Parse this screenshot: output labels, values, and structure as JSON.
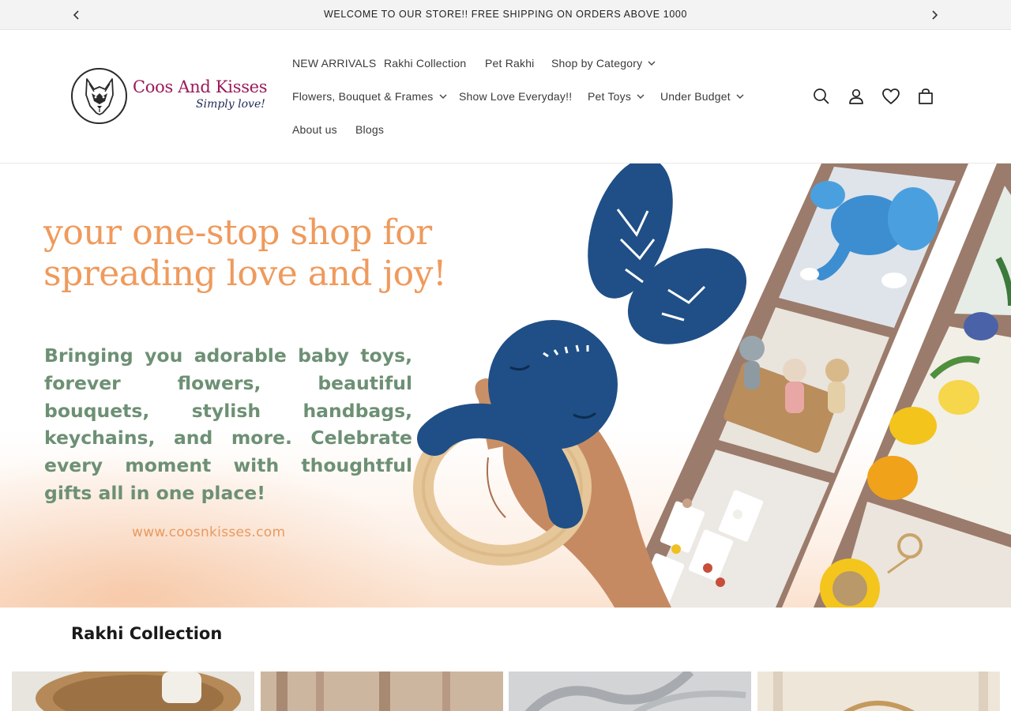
{
  "announcement": {
    "text": "WELCOME TO OUR STORE!! FREE SHIPPING ON ORDERS ABOVE 1000",
    "prev_icon": "chevron-left-icon",
    "next_icon": "chevron-right-icon"
  },
  "logo": {
    "brand": "Coos And Kisses",
    "tagline": "Simply love!",
    "emblem": "husky-dog-icon"
  },
  "nav": {
    "items": [
      {
        "label": "NEW ARRIVALS",
        "has_dropdown": false
      },
      {
        "label": "Rakhi Collection",
        "has_dropdown": false
      },
      {
        "label": "Pet Rakhi",
        "has_dropdown": false
      },
      {
        "label": "Shop by Category",
        "has_dropdown": true
      },
      {
        "label": "Flowers, Bouquet & Frames",
        "has_dropdown": true
      },
      {
        "label": "Show Love Everyday!!",
        "has_dropdown": false
      },
      {
        "label": "Pet Toys",
        "has_dropdown": true
      },
      {
        "label": "Under Budget",
        "has_dropdown": true
      },
      {
        "label": "About us",
        "has_dropdown": false
      },
      {
        "label": "Blogs",
        "has_dropdown": false
      }
    ]
  },
  "header_icons": [
    "search-icon",
    "account-icon",
    "wishlist-heart-icon",
    "cart-bag-icon"
  ],
  "hero": {
    "headline_line1": "your one-stop shop for",
    "headline_line2": "spreading love and joy!",
    "body": "Bringing you adorable baby toys, forever flowers, beautiful bouquets, stylish handbags, keychains, and more. Celebrate every moment with thoughtful gifts all in one place!",
    "url": "www.coosnkisses.com"
  },
  "section": {
    "title": "Rakhi Collection"
  },
  "colors": {
    "announcement_bg": "#f3f3f3",
    "brand_magenta": "#9c1a5a",
    "brand_navy": "#1f2a55",
    "hero_orange": "#ef9a5c",
    "hero_green": "#6d9074",
    "frame_brown": "#9b7b6b",
    "bunny_blue": "#1f4f86"
  }
}
